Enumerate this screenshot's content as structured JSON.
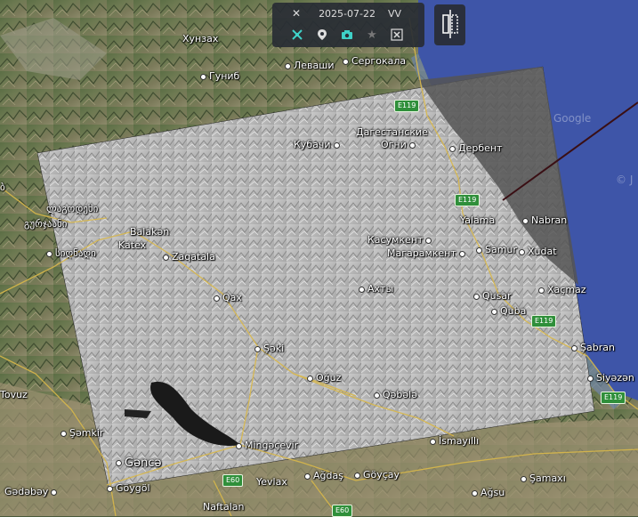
{
  "toolbar": {
    "date": "2025-07-22",
    "polarization": "VV",
    "buttons": [
      "close-icon",
      "crosshair-icon",
      "pin-icon",
      "camera-icon",
      "star-icon",
      "scissors-icon"
    ],
    "split_button": "split-view-icon"
  },
  "watermark": "Google",
  "watermark2": "© J",
  "places": {
    "hunzakh": "Хунзах",
    "gunib": "Гуниб",
    "levashi": "Леваши",
    "sergokala": "Сергокала",
    "kubachi": "Кубачи",
    "dagestan_ogni_1": "Дагестанские",
    "dagestan_ogni_2": "Огни",
    "derbent": "Дербент",
    "yalama": "Yalama",
    "nabran": "Nabran",
    "kasumkent": "Касумкент",
    "magaramkent": "Магарамкент",
    "samur": "Samur",
    "xudat": "Xudat",
    "akhty": "Ахты",
    "qusar": "Qusar",
    "xacmaz": "Xaçmaz",
    "quba": "Quba",
    "sabran": "Şabran",
    "siyazan": "Siyəzən",
    "balaken": "Balakən",
    "katex": "Katex",
    "zaqatala": "Zaqatala",
    "qax": "Qax",
    "seki": "Şəki",
    "oguz": "Oğuz",
    "qebele": "Qəbələ",
    "mingecevir": "Mingəçevir",
    "ismayilli": "İsmayıllı",
    "agdas": "Ağdaş",
    "goycay": "Göyçay",
    "yevlax": "Yevlax",
    "samaxi": "Şamaxı",
    "agsu": "Ağsu",
    "samkir": "Şəmkir",
    "ganca": "Gəncə",
    "gadabay": "Gədəbəy",
    "goygol": "Göygöl",
    "naftalan": "Naftalan",
    "tovuz": "Tovuz",
    "geo_1": "ლაგოდეხი",
    "geo_2": "გურჯაანი",
    "geo_3": "სიღნაღი",
    "geo_4": "ბ"
  },
  "shields": {
    "e119_a": "E119",
    "e119_b": "E119",
    "e119_c": "E119",
    "e119_d": "E119",
    "e60_a": "E60",
    "e60_b": "E60"
  }
}
